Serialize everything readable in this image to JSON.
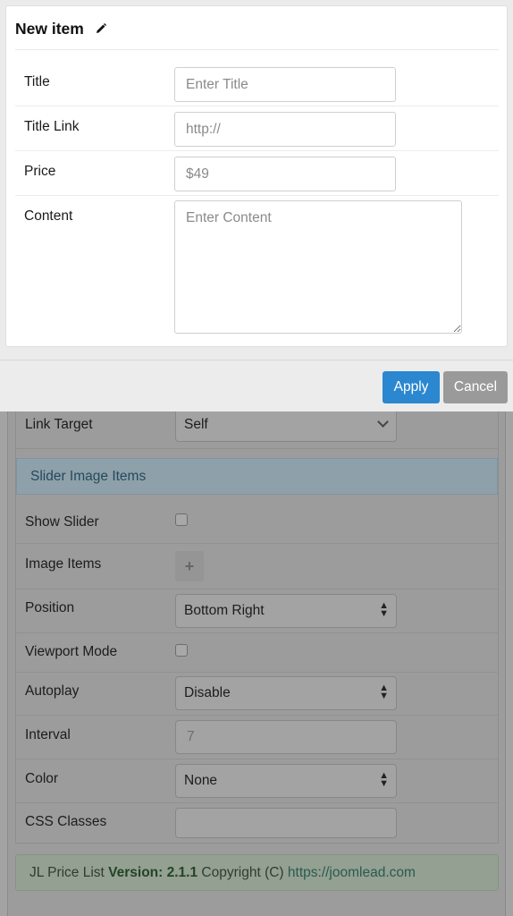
{
  "modal": {
    "title": "New item",
    "fields": {
      "title": {
        "label": "Title",
        "placeholder": "Enter Title"
      },
      "title_link": {
        "label": "Title Link",
        "placeholder": "http://"
      },
      "price": {
        "label": "Price",
        "placeholder": "$49"
      },
      "content": {
        "label": "Content",
        "placeholder": "Enter Content"
      }
    },
    "buttons": {
      "apply": "Apply",
      "cancel": "Cancel"
    }
  },
  "background_form": {
    "link_target": {
      "label": "Link Target",
      "value": "Self"
    },
    "section_title": "Slider Image Items",
    "show_slider": {
      "label": "Show Slider",
      "checked": false
    },
    "image_items": {
      "label": "Image Items",
      "button": "+"
    },
    "position": {
      "label": "Position",
      "value": "Bottom Right"
    },
    "viewport_mode": {
      "label": "Viewport Mode",
      "checked": false
    },
    "autoplay": {
      "label": "Autoplay",
      "value": "Disable"
    },
    "interval": {
      "label": "Interval",
      "value": "7"
    },
    "color": {
      "label": "Color",
      "value": "None"
    },
    "css_classes": {
      "label": "CSS Classes",
      "value": ""
    },
    "footer": {
      "product": "JL Price List",
      "version_label": "Version: 2.1.1",
      "copyright": "Copyright (C)",
      "link": "https://joomlead.com"
    }
  },
  "colors": {
    "apply_button": "#2b87cf",
    "cancel_button": "#9a9a9a"
  }
}
